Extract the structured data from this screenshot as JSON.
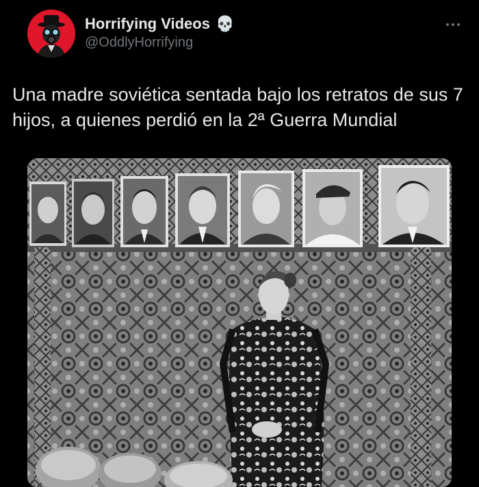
{
  "author": {
    "display_name": "Horrifying Videos",
    "badge_icon": "skull-icon",
    "badge_glyph": "💀",
    "handle": "@OddlyHorrifying",
    "avatar_color": "#e0162b"
  },
  "menu": {
    "icon": "more-options-icon"
  },
  "tweet": {
    "text": "Una madre soviética sentada bajo los retratos de sus 7 hijos, a quienes perdió en la 2ª Guerra Mundial"
  },
  "media": {
    "type": "photo",
    "portrait_count": 7
  },
  "colors": {
    "background": "#000000",
    "text": "#e7e9ea",
    "secondary_text": "#71767b"
  }
}
